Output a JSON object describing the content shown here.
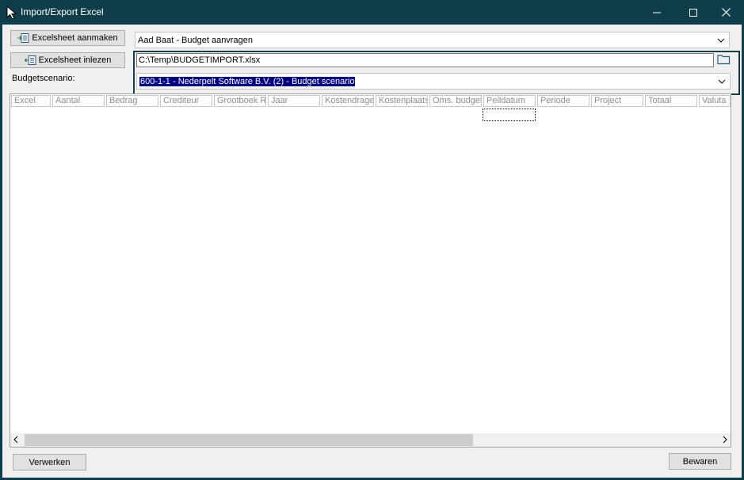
{
  "window": {
    "title": "Import/Export Excel",
    "titlebar_color": "#0f3e4a"
  },
  "toolbar": {
    "create_label": "Excelsheet aanmaken",
    "read_label": "Excelsheet inlezen",
    "scenario_label": "Budgetscenario:"
  },
  "fields": {
    "template": "Aad Baat - Budget aanvragen",
    "file_path": "C:\\Temp\\BUDGETIMPORT.xlsx",
    "scenario": "600-1-1 - Nederpelt Software B.V. (2) - Budget scenario",
    "selection_color": "#000080"
  },
  "grid": {
    "columns": [
      "Excel",
      "Aantal",
      "Bedrag",
      "Crediteur",
      "Grootboek Re",
      "Jaar",
      "Kostendrager",
      "Kostenplaats",
      "Oms. budget",
      "Peildatum",
      "Periode",
      "Project",
      "Totaal",
      "Valuta"
    ]
  },
  "footer": {
    "process_label": "Verwerken",
    "save_label": "Bewaren"
  }
}
